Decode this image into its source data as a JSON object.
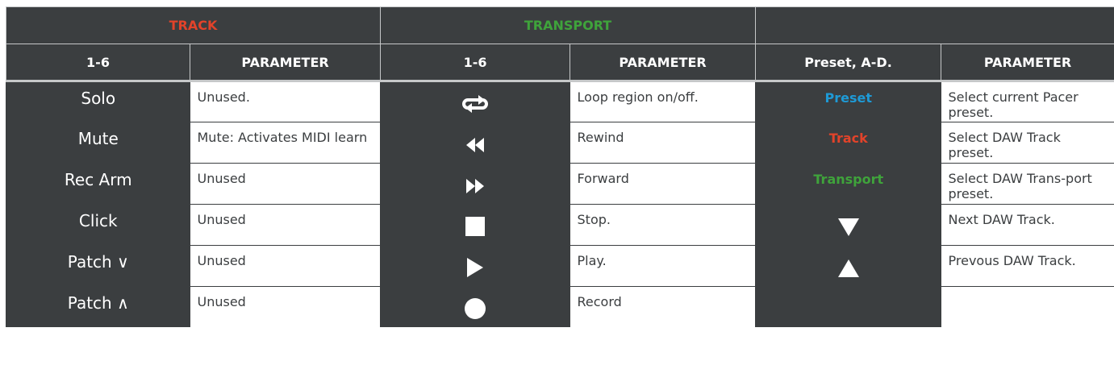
{
  "groups": [
    {
      "label": "TRACK",
      "color": "#e2432a"
    },
    {
      "label": "TRANSPORT",
      "color": "#3fa33b"
    },
    {
      "label": "",
      "color": "#ffffff"
    }
  ],
  "columns": [
    "1-6",
    "PARAMETER",
    "1-6",
    "PARAMETER",
    "Preset, A-D.",
    "PARAMETER"
  ],
  "track_rows": [
    {
      "key": "Solo",
      "param": "Unused."
    },
    {
      "key": "Mute",
      "param": "Mute: Activates MIDI learn"
    },
    {
      "key": "Rec Arm",
      "param": "Unused"
    },
    {
      "key": "Click",
      "param": "Unused"
    },
    {
      "key": "Patch ∨",
      "param": "Unused"
    },
    {
      "key": "Patch ∧",
      "param": "Unused"
    }
  ],
  "transport_rows": [
    {
      "icon": "loop-icon",
      "param": "Loop region on/off."
    },
    {
      "icon": "rewind-icon",
      "param": "Rewind"
    },
    {
      "icon": "forward-icon",
      "param": "Forward"
    },
    {
      "icon": "stop-icon",
      "param": "Stop."
    },
    {
      "icon": "play-icon",
      "param": "Play."
    },
    {
      "icon": "record-icon",
      "param": "Record"
    }
  ],
  "preset_rows": [
    {
      "label": "Preset",
      "color": "#1e9ad6",
      "param": "Select current Pacer preset."
    },
    {
      "label": "Track",
      "color": "#e2432a",
      "param": "Select DAW Track preset."
    },
    {
      "label": "Transport",
      "color": "#3fa33b",
      "param": "Select DAW Trans-port preset."
    },
    {
      "icon": "triangle-down-icon",
      "param": "Next DAW Track."
    },
    {
      "icon": "triangle-up-icon",
      "param": "Prevous DAW Track."
    },
    {
      "label": "",
      "param": ""
    }
  ],
  "colors": {
    "panel": "#3b3e40",
    "grid": "#c6c8c9",
    "text_light": "#ffffff",
    "text_dark": "#3b3e40"
  }
}
